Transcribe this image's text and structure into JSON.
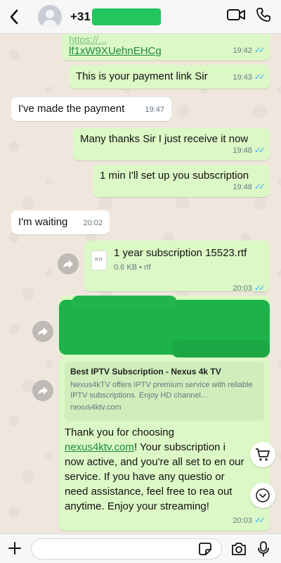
{
  "header": {
    "contact_prefix": "+31"
  },
  "messages": {
    "link_partial_line1": "https://...",
    "link_partial_line2": "lf1xW9XUehnEHCg",
    "link_time": "19:42",
    "payment_link": "This is your payment link Sir",
    "payment_link_time": "19:43",
    "made_payment": "I've made the payment",
    "made_payment_time": "19:47",
    "thanks": "Many thanks Sir I just receive it now",
    "thanks_time": "19:48",
    "setup": "1 min I'll set up you subscription",
    "setup_time": "19:48",
    "waiting": "I'm waiting",
    "waiting_time": "20:02",
    "file_name": "1 year subscription 15523.rtf",
    "file_meta": "0.6 KB • rtf",
    "file_icon_label": "RTF",
    "file_time": "20:03",
    "preview_title": "Best IPTV Subscription - Nexus 4k TV",
    "preview_desc": "Nexus4kTV offers IPTV premium service with reliable IPTV subscriptions. Enjoy HD channel...",
    "preview_domain": "nexus4ktv.com",
    "final_pre": "Thank you for choosing ",
    "final_link": "nexus4ktv.com",
    "final_post": "! Your subscription i now active, and you're all set to en our service. If you have any questio or need assistance, feel free to rea out anytime. Enjoy your streaming!",
    "final_time": "20:03"
  },
  "icons": {
    "back": "chevron-left-icon",
    "video": "video-call-icon",
    "phone": "phone-icon",
    "forward": "forward-icon",
    "cart": "cart-icon",
    "scroll_down": "chevron-down-icon",
    "plus": "plus-icon",
    "sticker": "sticker-icon",
    "camera": "camera-icon",
    "mic": "mic-icon"
  },
  "colors": {
    "outgoing_bubble": "#dcf8c6",
    "incoming_bubble": "#ffffff",
    "read_ticks": "#34b7f1",
    "redaction": "#22c55e"
  }
}
